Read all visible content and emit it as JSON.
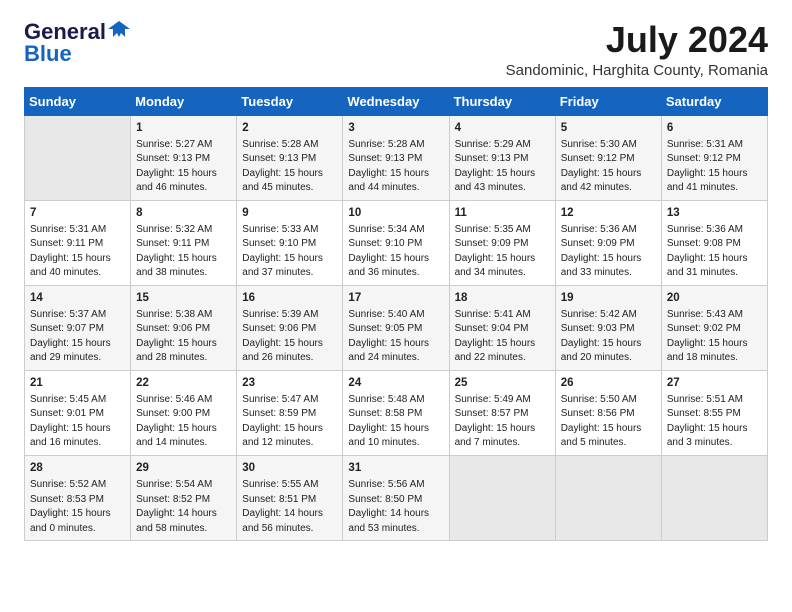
{
  "header": {
    "logo_general": "General",
    "logo_blue": "Blue",
    "month_year": "July 2024",
    "location": "Sandominic, Harghita County, Romania"
  },
  "days_of_week": [
    "Sunday",
    "Monday",
    "Tuesday",
    "Wednesday",
    "Thursday",
    "Friday",
    "Saturday"
  ],
  "weeks": [
    [
      {
        "day": "",
        "sunrise": "",
        "sunset": "",
        "daylight": ""
      },
      {
        "day": "1",
        "sunrise": "Sunrise: 5:27 AM",
        "sunset": "Sunset: 9:13 PM",
        "daylight": "Daylight: 15 hours and 46 minutes."
      },
      {
        "day": "2",
        "sunrise": "Sunrise: 5:28 AM",
        "sunset": "Sunset: 9:13 PM",
        "daylight": "Daylight: 15 hours and 45 minutes."
      },
      {
        "day": "3",
        "sunrise": "Sunrise: 5:28 AM",
        "sunset": "Sunset: 9:13 PM",
        "daylight": "Daylight: 15 hours and 44 minutes."
      },
      {
        "day": "4",
        "sunrise": "Sunrise: 5:29 AM",
        "sunset": "Sunset: 9:13 PM",
        "daylight": "Daylight: 15 hours and 43 minutes."
      },
      {
        "day": "5",
        "sunrise": "Sunrise: 5:30 AM",
        "sunset": "Sunset: 9:12 PM",
        "daylight": "Daylight: 15 hours and 42 minutes."
      },
      {
        "day": "6",
        "sunrise": "Sunrise: 5:31 AM",
        "sunset": "Sunset: 9:12 PM",
        "daylight": "Daylight: 15 hours and 41 minutes."
      }
    ],
    [
      {
        "day": "7",
        "sunrise": "Sunrise: 5:31 AM",
        "sunset": "Sunset: 9:11 PM",
        "daylight": "Daylight: 15 hours and 40 minutes."
      },
      {
        "day": "8",
        "sunrise": "Sunrise: 5:32 AM",
        "sunset": "Sunset: 9:11 PM",
        "daylight": "Daylight: 15 hours and 38 minutes."
      },
      {
        "day": "9",
        "sunrise": "Sunrise: 5:33 AM",
        "sunset": "Sunset: 9:10 PM",
        "daylight": "Daylight: 15 hours and 37 minutes."
      },
      {
        "day": "10",
        "sunrise": "Sunrise: 5:34 AM",
        "sunset": "Sunset: 9:10 PM",
        "daylight": "Daylight: 15 hours and 36 minutes."
      },
      {
        "day": "11",
        "sunrise": "Sunrise: 5:35 AM",
        "sunset": "Sunset: 9:09 PM",
        "daylight": "Daylight: 15 hours and 34 minutes."
      },
      {
        "day": "12",
        "sunrise": "Sunrise: 5:36 AM",
        "sunset": "Sunset: 9:09 PM",
        "daylight": "Daylight: 15 hours and 33 minutes."
      },
      {
        "day": "13",
        "sunrise": "Sunrise: 5:36 AM",
        "sunset": "Sunset: 9:08 PM",
        "daylight": "Daylight: 15 hours and 31 minutes."
      }
    ],
    [
      {
        "day": "14",
        "sunrise": "Sunrise: 5:37 AM",
        "sunset": "Sunset: 9:07 PM",
        "daylight": "Daylight: 15 hours and 29 minutes."
      },
      {
        "day": "15",
        "sunrise": "Sunrise: 5:38 AM",
        "sunset": "Sunset: 9:06 PM",
        "daylight": "Daylight: 15 hours and 28 minutes."
      },
      {
        "day": "16",
        "sunrise": "Sunrise: 5:39 AM",
        "sunset": "Sunset: 9:06 PM",
        "daylight": "Daylight: 15 hours and 26 minutes."
      },
      {
        "day": "17",
        "sunrise": "Sunrise: 5:40 AM",
        "sunset": "Sunset: 9:05 PM",
        "daylight": "Daylight: 15 hours and 24 minutes."
      },
      {
        "day": "18",
        "sunrise": "Sunrise: 5:41 AM",
        "sunset": "Sunset: 9:04 PM",
        "daylight": "Daylight: 15 hours and 22 minutes."
      },
      {
        "day": "19",
        "sunrise": "Sunrise: 5:42 AM",
        "sunset": "Sunset: 9:03 PM",
        "daylight": "Daylight: 15 hours and 20 minutes."
      },
      {
        "day": "20",
        "sunrise": "Sunrise: 5:43 AM",
        "sunset": "Sunset: 9:02 PM",
        "daylight": "Daylight: 15 hours and 18 minutes."
      }
    ],
    [
      {
        "day": "21",
        "sunrise": "Sunrise: 5:45 AM",
        "sunset": "Sunset: 9:01 PM",
        "daylight": "Daylight: 15 hours and 16 minutes."
      },
      {
        "day": "22",
        "sunrise": "Sunrise: 5:46 AM",
        "sunset": "Sunset: 9:00 PM",
        "daylight": "Daylight: 15 hours and 14 minutes."
      },
      {
        "day": "23",
        "sunrise": "Sunrise: 5:47 AM",
        "sunset": "Sunset: 8:59 PM",
        "daylight": "Daylight: 15 hours and 12 minutes."
      },
      {
        "day": "24",
        "sunrise": "Sunrise: 5:48 AM",
        "sunset": "Sunset: 8:58 PM",
        "daylight": "Daylight: 15 hours and 10 minutes."
      },
      {
        "day": "25",
        "sunrise": "Sunrise: 5:49 AM",
        "sunset": "Sunset: 8:57 PM",
        "daylight": "Daylight: 15 hours and 7 minutes."
      },
      {
        "day": "26",
        "sunrise": "Sunrise: 5:50 AM",
        "sunset": "Sunset: 8:56 PM",
        "daylight": "Daylight: 15 hours and 5 minutes."
      },
      {
        "day": "27",
        "sunrise": "Sunrise: 5:51 AM",
        "sunset": "Sunset: 8:55 PM",
        "daylight": "Daylight: 15 hours and 3 minutes."
      }
    ],
    [
      {
        "day": "28",
        "sunrise": "Sunrise: 5:52 AM",
        "sunset": "Sunset: 8:53 PM",
        "daylight": "Daylight: 15 hours and 0 minutes."
      },
      {
        "day": "29",
        "sunrise": "Sunrise: 5:54 AM",
        "sunset": "Sunset: 8:52 PM",
        "daylight": "Daylight: 14 hours and 58 minutes."
      },
      {
        "day": "30",
        "sunrise": "Sunrise: 5:55 AM",
        "sunset": "Sunset: 8:51 PM",
        "daylight": "Daylight: 14 hours and 56 minutes."
      },
      {
        "day": "31",
        "sunrise": "Sunrise: 5:56 AM",
        "sunset": "Sunset: 8:50 PM",
        "daylight": "Daylight: 14 hours and 53 minutes."
      },
      {
        "day": "",
        "sunrise": "",
        "sunset": "",
        "daylight": ""
      },
      {
        "day": "",
        "sunrise": "",
        "sunset": "",
        "daylight": ""
      },
      {
        "day": "",
        "sunrise": "",
        "sunset": "",
        "daylight": ""
      }
    ]
  ]
}
